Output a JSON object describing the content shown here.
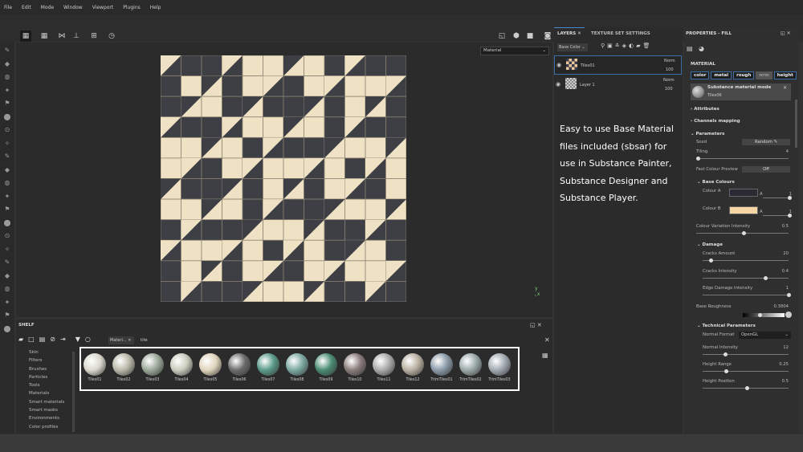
{
  "menu": [
    "File",
    "Edit",
    "Mode",
    "Window",
    "Viewport",
    "Plugins",
    "Help"
  ],
  "viewport": {
    "display_select": "Material"
  },
  "layers_panel": {
    "tabs": [
      "LAYERS",
      "TEXTURE SET SETTINGS"
    ],
    "channel_select": "Base Color",
    "layers": [
      {
        "name": "Tiles01",
        "blend": "Norm",
        "opacity": "100"
      },
      {
        "name": "Layer 1",
        "blend": "Norm",
        "opacity": "100"
      }
    ]
  },
  "overlay_text": "Easy to use Base Material files included (sbsar) for use in Substance Painter, Substance Designer and Substance Player.",
  "properties": {
    "title": "PROPERTIES - FILL",
    "material_label": "MATERIAL",
    "channels": [
      "color",
      "metal",
      "rough",
      "nrm",
      "height"
    ],
    "mode_title": "Substance material mode",
    "mode_material": "Tiles06",
    "sections": {
      "attributes": "Attributes",
      "channels_mapping": "Channels mapping",
      "parameters": "Parameters",
      "base_colours": "Base Colours",
      "damage": "Damage",
      "technical": "Technical Parameters"
    },
    "seed": {
      "label": "Seed",
      "value": "Random"
    },
    "tiling": {
      "label": "Tiling",
      "value": "4"
    },
    "fast_preview": {
      "label": "Fast Colour Preview",
      "value": "Off"
    },
    "colour_a": {
      "label": "Colour A",
      "alpha": "1",
      "color": "#2a2a35"
    },
    "colour_b": {
      "label": "Colour B",
      "alpha": "1",
      "color": "#f7d6a6"
    },
    "colour_variation": {
      "label": "Colour Variation Intensity",
      "value": "0.5",
      "fraction": 0.5
    },
    "cracks_amount": {
      "label": "Cracks Amount",
      "value": "20",
      "fraction": 0.08
    },
    "cracks_intensity": {
      "label": "Cracks Intensity",
      "value": "0.4",
      "fraction": 0.72
    },
    "edge_damage": {
      "label": "Edge Damage Intensity",
      "value": "1",
      "fraction": 1
    },
    "base_roughness": {
      "label": "Base Roughness",
      "value": "0.3804",
      "fraction": 0.38
    },
    "normal_format": {
      "label": "Normal Format",
      "value": "OpenGL"
    },
    "normal_intensity": {
      "label": "Normal Intensity",
      "value": "12",
      "fraction": 0.25
    },
    "height_range": {
      "label": "Height Range",
      "value": "0.25",
      "fraction": 0.26
    },
    "height_position": {
      "label": "Height Position",
      "value": "0.5",
      "fraction": 0.5
    }
  },
  "shelf": {
    "title": "SHELF",
    "filter_tab": "Materi...",
    "search": "tile",
    "categories": [
      "Skin",
      "Filters",
      "Brushes",
      "Particles",
      "Tools",
      "Materials",
      "Smart materials",
      "Smart masks",
      "Environments",
      "Color profiles"
    ],
    "materials": [
      "Tiles01",
      "Tiles02",
      "Tiles03",
      "Tiles04",
      "Tiles05",
      "Tiles06",
      "Tiles07",
      "Tiles08",
      "Tiles09",
      "Tiles10",
      "Tiles11",
      "Tiles12",
      "TrimTiles01",
      "TrimTiles02",
      "TrimTiles03"
    ]
  }
}
